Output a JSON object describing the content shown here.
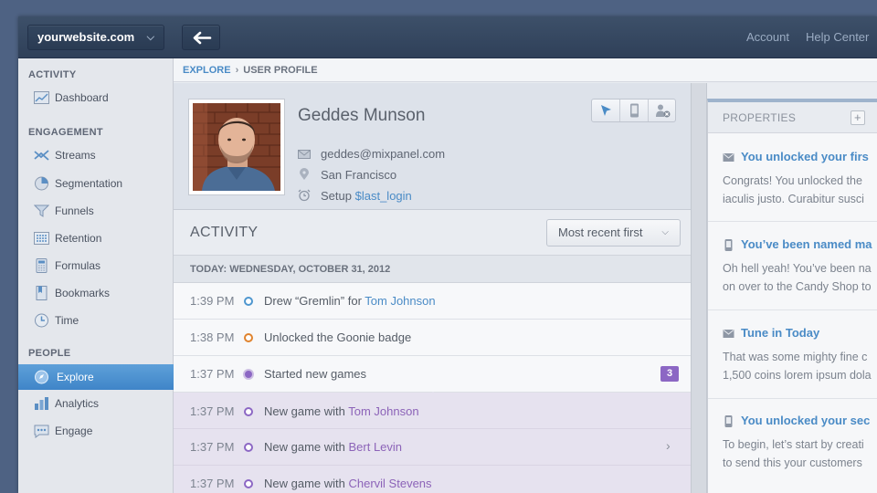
{
  "header": {
    "site_select": "yourwebsite.com",
    "account": "Account",
    "help_center": "Help Center"
  },
  "sidebar": {
    "sections": [
      {
        "title": "ACTIVITY",
        "items": [
          {
            "label": "Dashboard",
            "icon": "dashboard-icon"
          }
        ]
      },
      {
        "title": "ENGAGEMENT",
        "items": [
          {
            "label": "Streams",
            "icon": "streams-icon"
          },
          {
            "label": "Segmentation",
            "icon": "segmentation-icon"
          },
          {
            "label": "Funnels",
            "icon": "funnel-icon"
          },
          {
            "label": "Retention",
            "icon": "retention-icon"
          },
          {
            "label": "Formulas",
            "icon": "calculator-icon"
          },
          {
            "label": "Bookmarks",
            "icon": "bookmark-icon"
          },
          {
            "label": "Time",
            "icon": "clock-icon"
          }
        ]
      },
      {
        "title": "PEOPLE",
        "items": [
          {
            "label": "Explore",
            "icon": "explore-icon",
            "active": true
          },
          {
            "label": "Analytics",
            "icon": "analytics-icon"
          },
          {
            "label": "Engage",
            "icon": "engage-icon"
          }
        ]
      }
    ]
  },
  "breadcrumb": {
    "root": "EXPLORE",
    "separator": "›",
    "current": "USER PROFILE"
  },
  "profile": {
    "name": "Geddes Munson",
    "email": "geddes@mixpanel.com",
    "location": "San Francisco",
    "setup_prefix": "Setup",
    "setup_link": "$last_login"
  },
  "activity": {
    "title": "ACTIVITY",
    "sort": "Most recent first",
    "date_header": "TODAY: WEDNESDAY, OCTOBER 31, 2012",
    "events": [
      {
        "time": "1:39 PM",
        "text": "Drew “Gremlin” for ",
        "name": "Tom Johnson",
        "dot": "#4e96cf"
      },
      {
        "time": "1:38 PM",
        "text": "Unlocked the Goonie badge",
        "name": "",
        "dot": "#e0832e"
      },
      {
        "time": "1:37 PM",
        "text": "Started new games",
        "name": "",
        "dot": "#8c67c4",
        "badge": "3"
      }
    ],
    "sub_events": [
      {
        "time": "1:37 PM",
        "text": "New game with ",
        "name": "Tom Johnson"
      },
      {
        "time": "1:37 PM",
        "text": "New game with ",
        "name": "Bert Levin",
        "arrow": "›"
      },
      {
        "time": "1:37 PM",
        "text": "New game with ",
        "name": "Chervil Stevens"
      }
    ]
  },
  "properties": {
    "title": "PROPERTIES",
    "add": "+",
    "items": [
      {
        "icon": "mail-icon",
        "title": "You unlocked your firs",
        "lines": [
          "Congrats! You unlocked the",
          "iaculis justo. Curabitur susci"
        ]
      },
      {
        "icon": "phone-icon",
        "title": "You’ve been named ma",
        "lines": [
          "Oh hell yeah! You’ve been na",
          "on over to the Candy Shop to"
        ]
      },
      {
        "icon": "mail-icon",
        "title": "Tune in Today",
        "lines": [
          "That was some mighty fine c",
          "1,500 coins lorem ipsum dola"
        ]
      },
      {
        "icon": "phone-icon",
        "title": "You unlocked your sec",
        "lines": [
          "To begin, let’s start by creati",
          "to send this your customers"
        ]
      }
    ]
  }
}
